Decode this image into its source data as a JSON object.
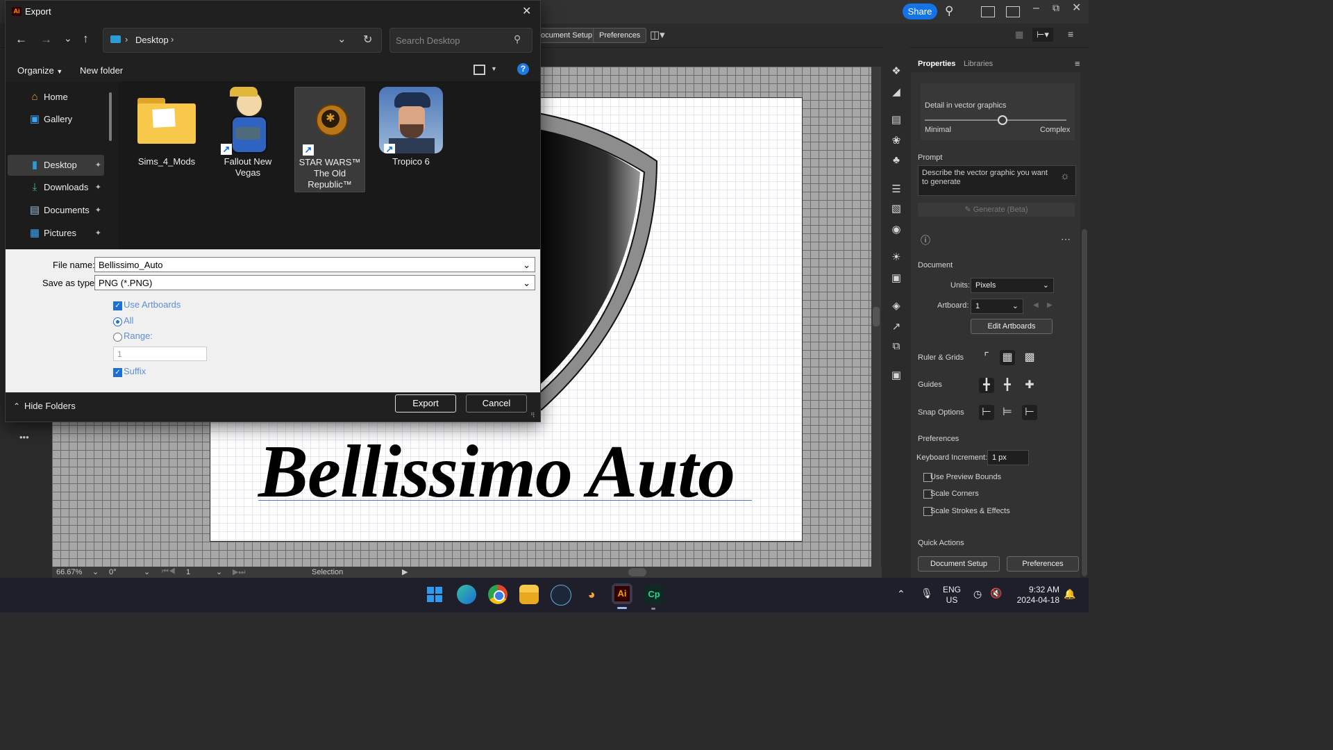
{
  "ai": {
    "share_label": "Share",
    "doc_setup_label": "ocument Setup",
    "preferences_label": "Preferences",
    "logo_text": "Bellissimo Auto",
    "status": {
      "zoom": "66.67%",
      "rotation": "0°",
      "artboard_num": "1",
      "tool": "Selection"
    },
    "more_tools_label": "•••"
  },
  "props": {
    "tabs": [
      "Properties",
      "Libraries"
    ],
    "detail_label": "Detail in vector graphics",
    "detail_min": "Minimal",
    "detail_max": "Complex",
    "detail_level": 0.55,
    "prompt_label": "Prompt",
    "prompt_placeholder": "Describe the vector graphic you want to generate",
    "generate_label": "Generate (Beta)",
    "document_label": "Document",
    "units_label": "Units:",
    "units_value": "Pixels",
    "artboard_label": "Artboard:",
    "artboard_value": "1",
    "edit_artboards_label": "Edit Artboards",
    "ruler_grids_label": "Ruler & Grids",
    "guides_label": "Guides",
    "snap_label": "Snap Options",
    "preferences_label": "Preferences",
    "keyboard_increment_label": "Keyboard Increment:",
    "keyboard_increment_value": "1 px",
    "use_preview_bounds": "Use Preview Bounds",
    "scale_corners": "Scale Corners",
    "scale_strokes": "Scale Strokes & Effects",
    "quick_actions_label": "Quick Actions",
    "qa_document_setup": "Document Setup",
    "qa_preferences": "Preferences"
  },
  "dialog": {
    "title": "Export",
    "app_badge": "Ai",
    "breadcrumb": "Desktop",
    "search_placeholder": "Search Desktop",
    "organize_label": "Organize",
    "new_folder_label": "New folder",
    "help_label": "?",
    "nav": [
      {
        "label": "Home",
        "icon": "home-icon",
        "pinned": false
      },
      {
        "label": "Gallery",
        "icon": "gallery-icon",
        "pinned": false
      },
      {
        "label": "Desktop",
        "icon": "desktop-icon",
        "pinned": true
      },
      {
        "label": "Downloads",
        "icon": "downloads-icon",
        "pinned": true
      },
      {
        "label": "Documents",
        "icon": "documents-icon",
        "pinned": true
      },
      {
        "label": "Pictures",
        "icon": "pictures-icon",
        "pinned": true
      }
    ],
    "files": [
      {
        "name": "Sims_4_Mods",
        "kind": "folder"
      },
      {
        "name": "Fallout New Vegas",
        "kind": "shortcut"
      },
      {
        "name": "STAR WARS™ The Old Republic™",
        "kind": "shortcut"
      },
      {
        "name": "Tropico 6",
        "kind": "shortcut"
      }
    ],
    "file_name_label": "File name:",
    "file_name_value": "Bellissimo_Auto",
    "save_type_label": "Save as type:",
    "save_type_value": "PNG (*.PNG)",
    "use_artboards_label": "Use Artboards",
    "all_label": "All",
    "range_label": "Range:",
    "range_value": "1",
    "suffix_label": "Suffix",
    "hide_folders_label": "Hide Folders",
    "export_label": "Export",
    "cancel_label": "Cancel"
  },
  "taskbar": {
    "lang_top": "ENG",
    "lang_bottom": "US",
    "time": "9:32 AM",
    "date": "2024-04-18",
    "apps": [
      "windows-start",
      "edge",
      "chrome",
      "file-explorer",
      "steam",
      "app-bowl",
      "illustrator",
      "captivate"
    ],
    "ai_label": "Ai",
    "cp_label": "Cp"
  }
}
